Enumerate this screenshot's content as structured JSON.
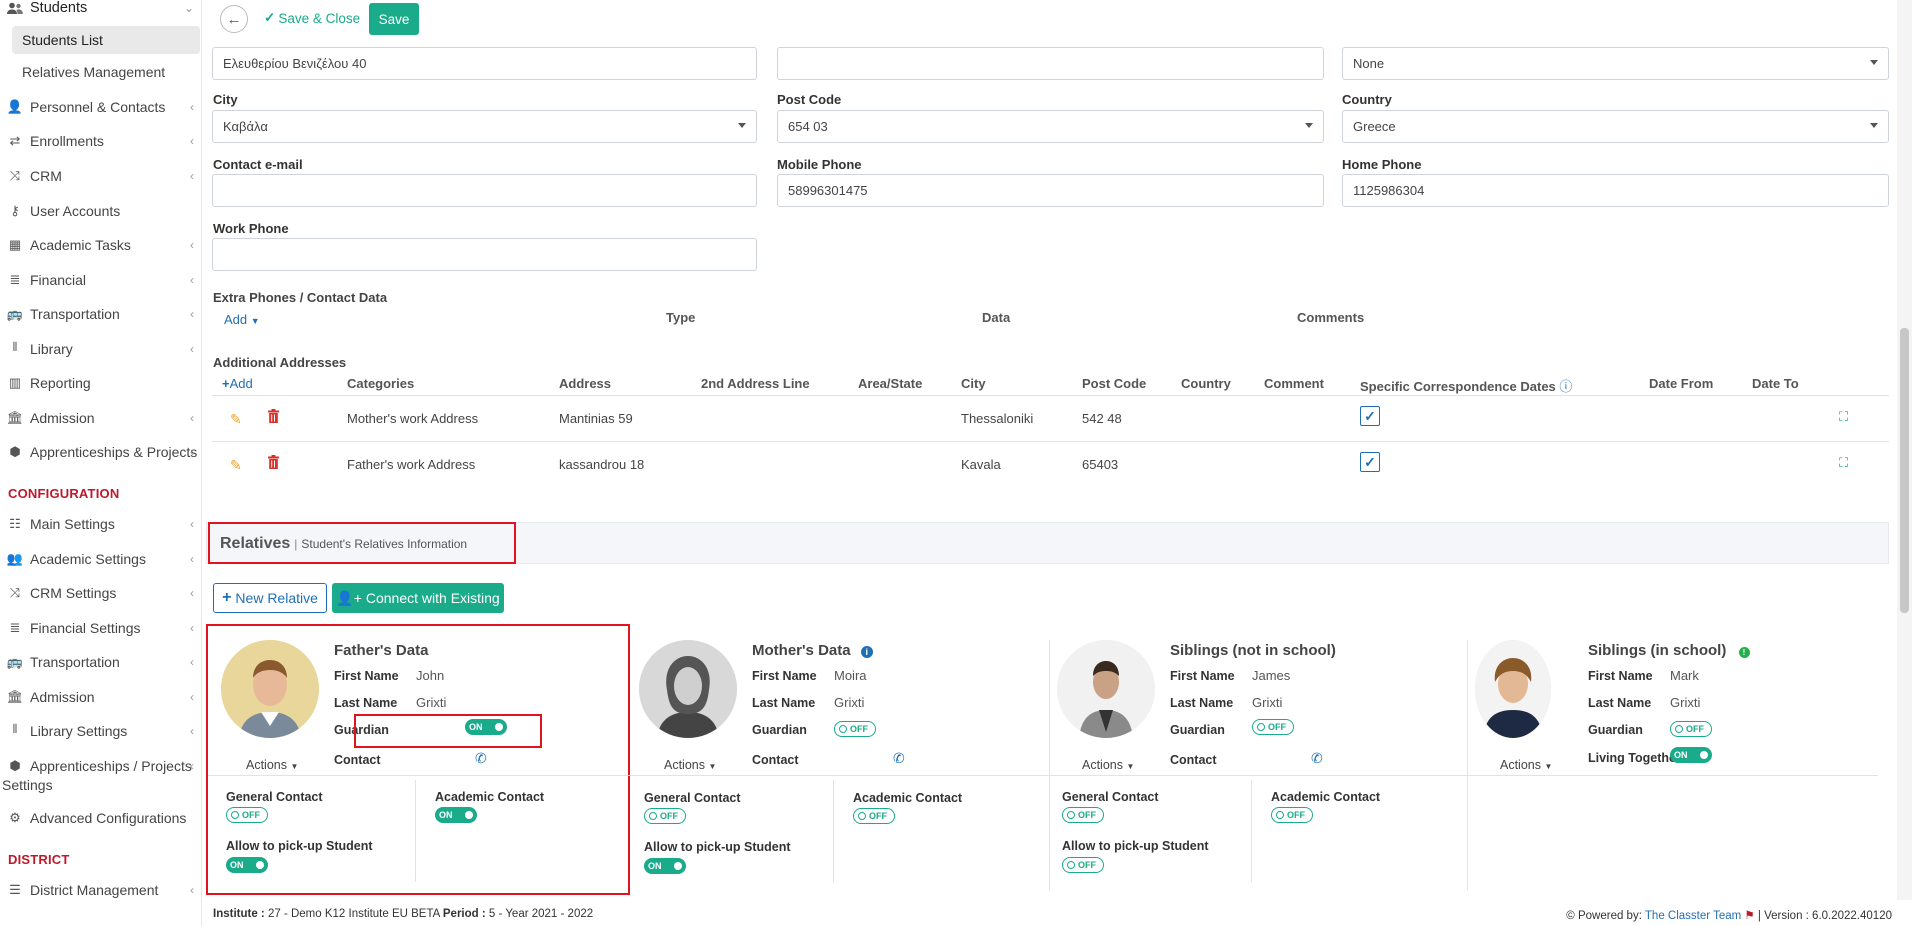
{
  "sidebar": {
    "top_item": "Students",
    "sub_items": [
      "Students List",
      "Relatives Management"
    ],
    "items": [
      "Personnel & Contacts",
      "Enrollments",
      "CRM",
      "User Accounts",
      "Academic Tasks",
      "Financial",
      "Transportation",
      "Library",
      "Reporting",
      "Admission",
      "Apprenticeships & Projects"
    ],
    "config_header": "CONFIGURATION",
    "config_items": [
      "Main Settings",
      "Academic Settings",
      "CRM Settings",
      "Financial Settings",
      "Transportation",
      "Admission",
      "Library Settings"
    ],
    "config_multiline_1": "Apprenticeships / Projects",
    "config_multiline_2": "Settings",
    "config_advanced": "Advanced Configurations",
    "district_header": "DISTRICT",
    "district_items": [
      "District Management"
    ]
  },
  "toolbar": {
    "save_close": "Save & Close",
    "save": "Save"
  },
  "form": {
    "address_value": "Ελευθερίου Βενιζέλου 40",
    "address2_value": "",
    "area_value": "None",
    "city_label": "City",
    "city_value": "Καβάλα",
    "post_code_label": "Post Code",
    "post_code_value": "654 03",
    "country_label": "Country",
    "country_value": "Greece",
    "email_label": "Contact e-mail",
    "email_value": "",
    "mobile_label": "Mobile Phone",
    "mobile_value": "58996301475",
    "home_label": "Home Phone",
    "home_value": "1125986304",
    "work_label": "Work Phone",
    "work_value": ""
  },
  "extra_phones": {
    "title": "Extra Phones / Contact Data",
    "add": "Add",
    "cols": [
      "Type",
      "Data",
      "Comments"
    ]
  },
  "addresses": {
    "title": "Additional Addresses",
    "add": "Add",
    "cols": [
      "Categories",
      "Address",
      "2nd Address Line",
      "Area/State",
      "City",
      "Post Code",
      "Country",
      "Comment",
      "Specific Correspondence Dates",
      "Date From",
      "Date To"
    ],
    "rows": [
      {
        "category": "Mother's work Address",
        "address": "Mantinias 59",
        "city": "Thessaloniki",
        "post_code": "542 48"
      },
      {
        "category": "Father's work Address",
        "address": "kassandrou 18",
        "city": "Kavala",
        "post_code": "65403"
      }
    ]
  },
  "relatives": {
    "title": "Relatives",
    "subtitle": "Student's Relatives Information",
    "new_btn": "New Relative",
    "connect_btn": "Connect with Existing",
    "labels": {
      "first": "First Name",
      "last": "Last Name",
      "guardian": "Guardian",
      "contact": "Contact",
      "living": "Living Together",
      "actions": "Actions",
      "general": "General Contact",
      "academic": "Academic Contact",
      "pickup": "Allow to pick-up Student",
      "on": "ON",
      "off": "OFF"
    },
    "cards": [
      {
        "title": "Father's Data",
        "first": "John",
        "last": "Grixti"
      },
      {
        "title": "Mother's Data",
        "first": "Moira",
        "last": "Grixti"
      },
      {
        "title": "Siblings (not in school)",
        "first": "James",
        "last": "Grixti"
      },
      {
        "title": "Siblings (in school)",
        "first": "Mark",
        "last": "Grixti"
      }
    ]
  },
  "footer": {
    "institute_label": "Institute :",
    "institute_value": "27 - Demo K12 Institute EU BETA",
    "period_label": "Period :",
    "period_value": "5 - Year 2021 - 2022",
    "powered": "Powered by:",
    "team": "The Classter Team",
    "version": "| Version : 6.0.2022.40120"
  },
  "colors": {
    "accent": "#1aab8a",
    "link": "#1f6fb5",
    "highlight": "#e0141e",
    "section": "#c0182b"
  }
}
